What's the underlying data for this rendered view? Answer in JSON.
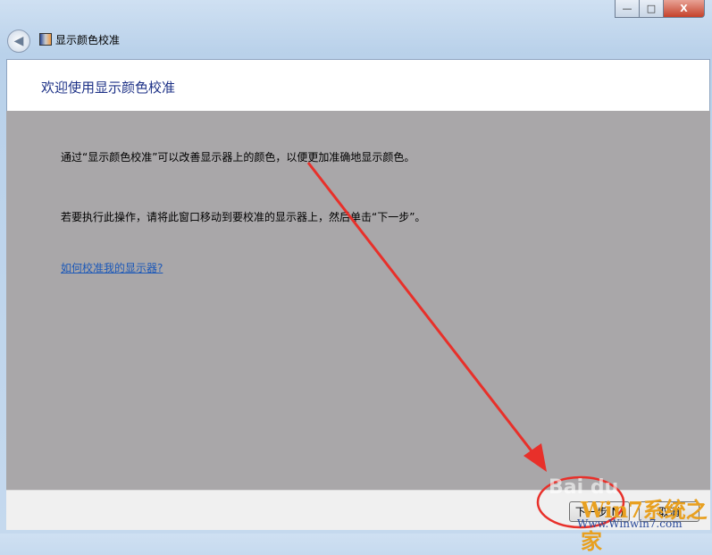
{
  "window": {
    "title": "显示颜色校准",
    "minimize": "—",
    "maximize": "□",
    "close": "X"
  },
  "header": {
    "title": "欢迎使用显示颜色校准"
  },
  "main": {
    "line1": "通过“显示颜色校准”可以改善显示器上的颜色，以便更加准确地显示颜色。",
    "line2": "若要执行此操作，请将此窗口移动到要校准的显示器上，然后单击“下一步”。",
    "link": "如何校准我的显示器?"
  },
  "footer": {
    "next": "下一步(N)",
    "cancel": "取消"
  },
  "watermark": {
    "brand": "Win7系统之家",
    "url": "Www.Winwin7.com",
    "baidu": "Bai du"
  },
  "colors": {
    "accent": "#1e3287",
    "arrow": "#e8302a",
    "gray": "#a9a7a9"
  }
}
